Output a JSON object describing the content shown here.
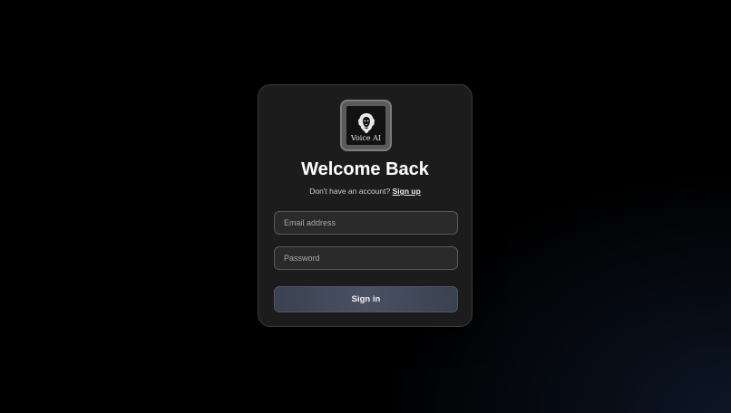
{
  "logo": {
    "icon": "lion-head-icon",
    "text": "Voice AI"
  },
  "title": "Welcome Back",
  "signup_prompt": {
    "text": "Don't have an account?",
    "link_label": "Sign up"
  },
  "form": {
    "email_placeholder": "Email address",
    "password_placeholder": "Password",
    "submit_label": "Sign in"
  },
  "colors": {
    "background": "#000000",
    "card": "#1c1c1c",
    "button_accent": "#4a5163"
  }
}
